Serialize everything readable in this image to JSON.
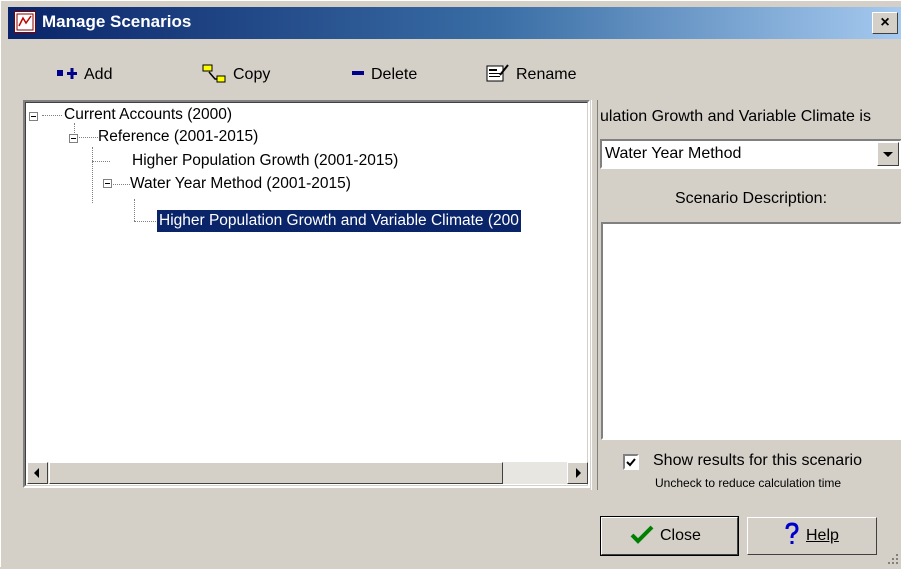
{
  "window": {
    "title": "Manage Scenarios",
    "close_glyph": "×"
  },
  "toolbar": {
    "add_label": "Add",
    "copy_label": "Copy",
    "delete_label": "Delete",
    "rename_label": "Rename"
  },
  "tree": {
    "nodes": [
      {
        "label": "Current Accounts (2000)"
      },
      {
        "label": "Reference (2001-2015)"
      },
      {
        "label": "Higher Population Growth (2001-2015)"
      },
      {
        "label": "Water Year Method (2001-2015)"
      },
      {
        "label": "Higher Population Growth and Variable Climate (200"
      }
    ]
  },
  "right": {
    "scenario_title": "ulation Growth and Variable Climate is",
    "combo_value": "Water Year Method",
    "description_label": "Scenario Description:",
    "show_results_label": "Show results for this scenario",
    "show_results_checked": true,
    "hint": "Uncheck to reduce calculation time"
  },
  "buttons": {
    "close_label": "Close",
    "help_label": "Help"
  },
  "colors": {
    "title_bar": "#0a246a",
    "selection": "#0a246a",
    "face": "#d4d0c8"
  }
}
